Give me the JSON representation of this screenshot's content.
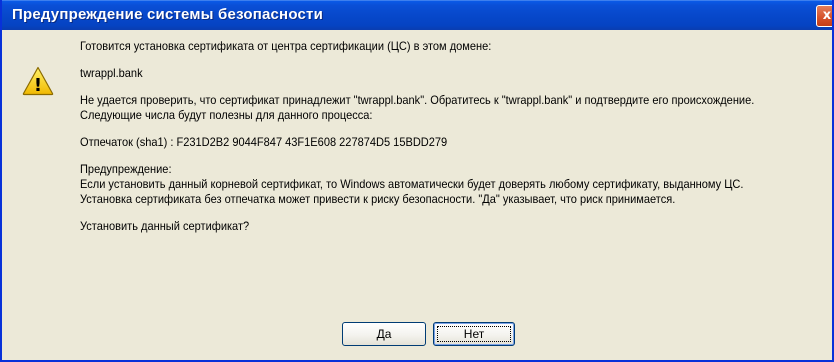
{
  "window": {
    "title": "Предупреждение системы безопасности",
    "close_glyph": "x"
  },
  "icon": {
    "name": "warning-icon",
    "glyph": "!"
  },
  "message": {
    "intro": "Готовится установка сертификата от центра сертификации (ЦС) в этом домене:",
    "domain": "twrappl.bank",
    "verify_line1": "Не удается проверить, что сертификат принадлежит \"twrappl.bank\". Обратитесь к \"twrappl.bank\" и подтвердите его происхождение.",
    "verify_line2": "Следующие числа будут полезны для данного процесса:",
    "thumbprint": "Отпечаток (sha1) : F231D2B2 9044F847 43F1E608 227874D5 15BDD279",
    "warning_heading": "Предупреждение:",
    "warning_line1": "Если установить данный корневой сертификат, то Windows автоматически будет доверять любому сертификату, выданному ЦС.",
    "warning_line2": "Установка сертификата без отпечатка может привести к риску безопасности. \"Да\" указывает, что риск принимается.",
    "question": "Установить данный сертификат?"
  },
  "buttons": {
    "yes_label": "Да",
    "no_label": "Нет"
  },
  "colors": {
    "titlebar": "#0748cb",
    "dialog_bg": "#ece9d8",
    "warning_yellow": "#ffd800"
  }
}
